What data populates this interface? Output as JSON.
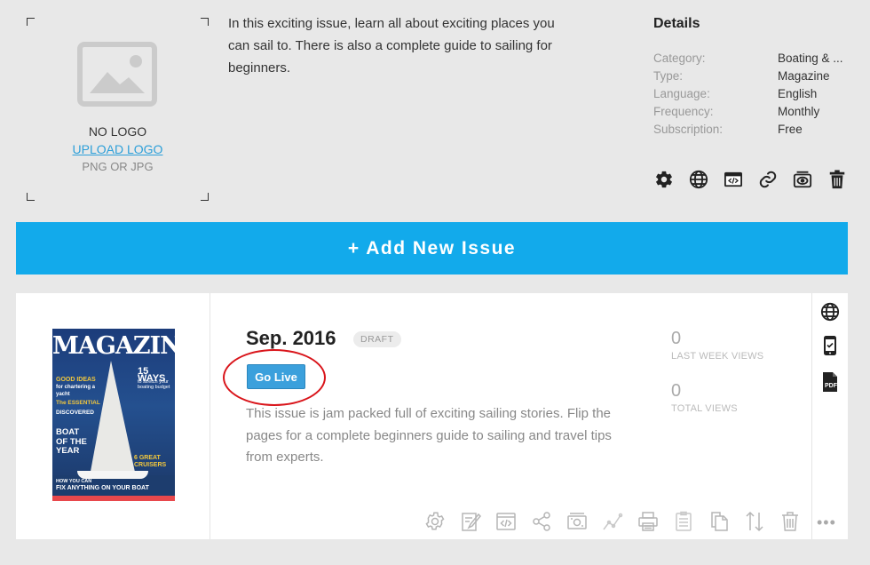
{
  "publication": {
    "logo": {
      "no_logo": "NO LOGO",
      "upload_logo": "UPLOAD LOGO",
      "formats": "PNG OR JPG"
    },
    "description": "In this exciting issue, learn all about exciting places you can sail to. There is also a complete guide to sailing for beginners.",
    "details": {
      "title": "Details",
      "rows": [
        {
          "key": "Category:",
          "value": "Boating & ..."
        },
        {
          "key": "Type:",
          "value": "Magazine"
        },
        {
          "key": "Language:",
          "value": "English"
        },
        {
          "key": "Frequency:",
          "value": "Monthly"
        },
        {
          "key": "Subscription:",
          "value": "Free"
        }
      ]
    },
    "actions": [
      "gear-icon",
      "globe-icon",
      "embed-icon",
      "link-icon",
      "subscribe-icon",
      "trash-icon"
    ]
  },
  "add_issue": {
    "label": "+ Add New Issue"
  },
  "issue": {
    "cover": {
      "masthead": "MAGAZINE",
      "lines": [
        "15 WAYS",
        "to stretch your boating budget",
        "GOOD IDEAS",
        "for chartering a yacht",
        "The ESSENTIAL",
        "DISCOVERED",
        "BOAT OF THE YEAR",
        "6 GREAT CRUISERS",
        "HOW YOU CAN",
        "FIX ANYTHING ON YOUR BOAT"
      ]
    },
    "title": "Sep. 2016",
    "status": "DRAFT",
    "go_live": "Go Live",
    "description": "This issue is jam packed full of exciting sailing stories. Flip the pages for a complete beginners guide to sailing and travel tips from experts.",
    "stats": {
      "last_week_views": {
        "value": "0",
        "label": "LAST WEEK VIEWS"
      },
      "total_views": {
        "value": "0",
        "label": "TOTAL VIEWS"
      }
    },
    "side_actions": [
      "globe-icon",
      "mobile-icon",
      "pdf-icon"
    ],
    "actions": [
      "gear-icon",
      "edit-icon",
      "embed-icon",
      "share-icon",
      "sell-icon",
      "stats-icon",
      "print-icon",
      "toc-icon",
      "copy-icon",
      "reorder-icon",
      "trash-icon"
    ],
    "more": "•••"
  },
  "colors": {
    "accent": "#12aaeb",
    "go_live": "#3ba0dc",
    "annotation": "#d9141a",
    "background": "#e8e8e8"
  }
}
